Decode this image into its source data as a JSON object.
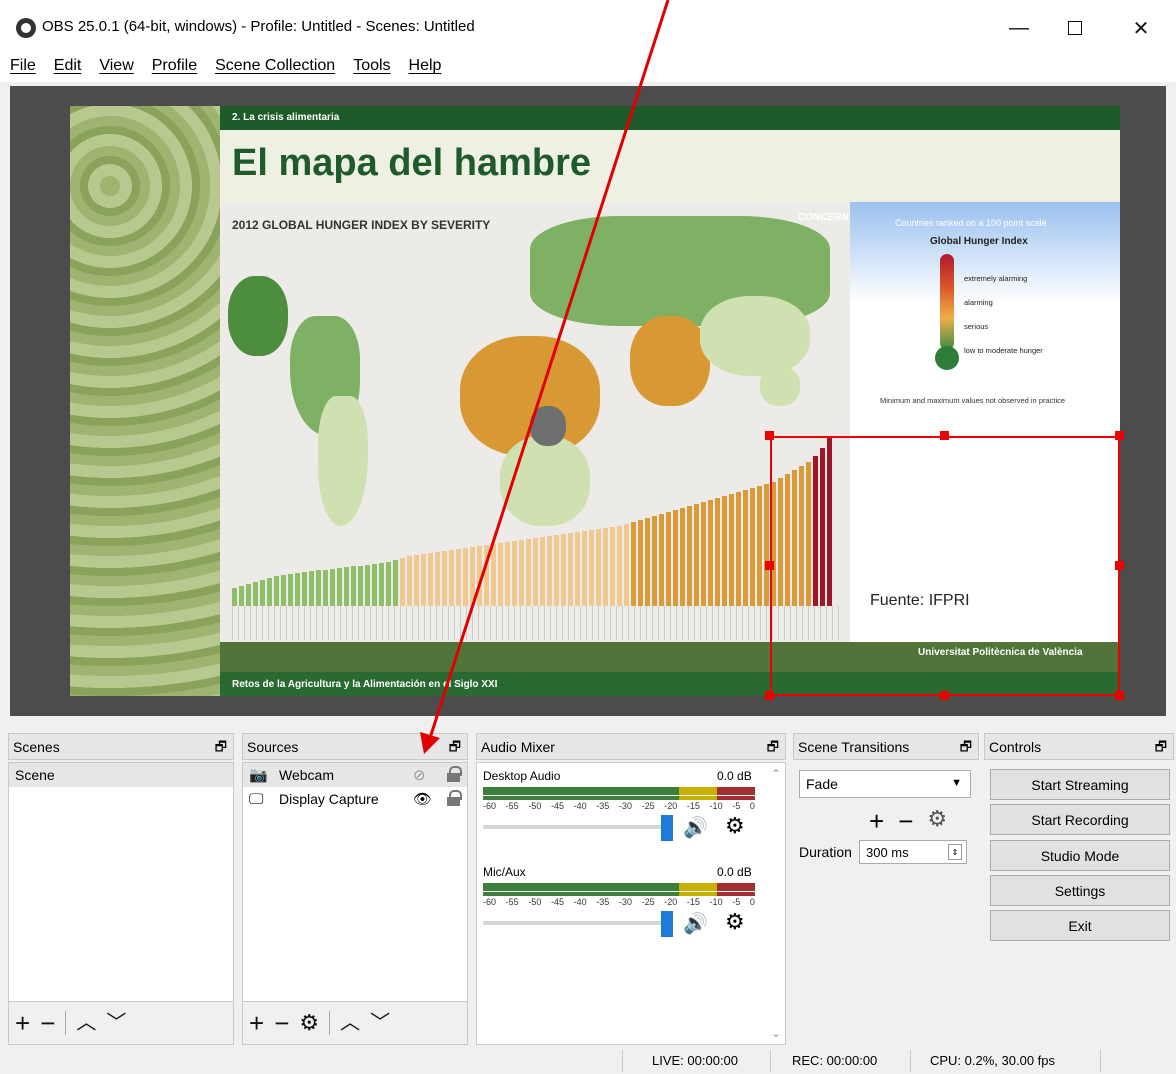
{
  "window": {
    "title": "OBS 25.0.1 (64-bit, windows) - Profile: Untitled - Scenes: Untitled",
    "minimize": "—",
    "close": "✕"
  },
  "menu": [
    "File",
    "Edit",
    "View",
    "Profile",
    "Scene Collection",
    "Tools",
    "Help"
  ],
  "preview_slide": {
    "subtitle": "2. La crisis alimentaria",
    "title": "El mapa del hambre",
    "map_heading": "2012 GLOBAL HUNGER INDEX BY SEVERITY",
    "logo": "CONCERN",
    "legend_top": "Countries ranked on a 100 point scale",
    "legend_title": "Global Hunger Index",
    "legend_levels": [
      "extremely alarming",
      "alarming",
      "serious",
      "low to moderate hunger"
    ],
    "legend_note": "Minimum and maximum values not observed in practice",
    "source": "Fuente: IFPRI",
    "university": "Universitat Politècnica de València",
    "footer": "Retos de la Agricultura y la Alimentación en el Siglo XXI"
  },
  "scenes": {
    "header": "Scenes",
    "items": [
      "Scene"
    ]
  },
  "sources": {
    "header": "Sources",
    "items": [
      {
        "label": "Webcam",
        "icon": "camera-icon",
        "visible": false
      },
      {
        "label": "Display Capture",
        "icon": "monitor-icon",
        "visible": true
      }
    ]
  },
  "mixer": {
    "header": "Audio Mixer",
    "scale": [
      "-60",
      "-55",
      "-50",
      "-45",
      "-40",
      "-35",
      "-30",
      "-25",
      "-20",
      "-15",
      "-10",
      "-5",
      "0"
    ],
    "channels": [
      {
        "name": "Desktop Audio",
        "db": "0.0 dB",
        "volume": 1.0
      },
      {
        "name": "Mic/Aux",
        "db": "0.0 dB",
        "volume": 1.0
      }
    ]
  },
  "transitions": {
    "header": "Scene Transitions",
    "selected": "Fade",
    "duration_label": "Duration",
    "duration_value": "300 ms"
  },
  "controls": {
    "header": "Controls",
    "buttons": [
      "Start Streaming",
      "Start Recording",
      "Studio Mode",
      "Settings",
      "Exit"
    ]
  },
  "status": {
    "live": "LIVE: 00:00:00",
    "rec": "REC: 00:00:00",
    "cpu": "CPU: 0.2%, 30.00 fps"
  },
  "colors": {
    "selection": "#e00000",
    "slide_green": "#1e5a2a",
    "fader_blue": "#1e7bd6"
  }
}
